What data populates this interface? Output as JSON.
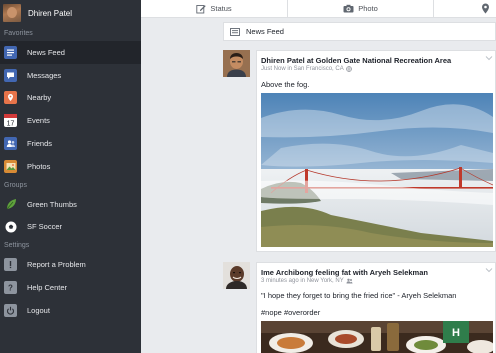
{
  "profile": {
    "name": "Dhiren Patel"
  },
  "sidebar": {
    "favorites_label": "Favorites",
    "groups_label": "Groups",
    "settings_label": "Settings",
    "favorites": [
      {
        "label": "News Feed",
        "icon": "news-feed-icon",
        "color": "#4267b2"
      },
      {
        "label": "Messages",
        "icon": "messages-icon",
        "color": "#4267b2"
      },
      {
        "label": "Nearby",
        "icon": "nearby-icon",
        "color": "#e8744a"
      },
      {
        "label": "Events",
        "icon": "events-icon",
        "color": "#d23a3a"
      },
      {
        "label": "Friends",
        "icon": "friends-icon",
        "color": "#4267b2"
      },
      {
        "label": "Photos",
        "icon": "photos-icon",
        "color": "#d88b35"
      }
    ],
    "groups": [
      {
        "label": "Green Thumbs",
        "icon": "leaf-icon",
        "color": "#5fa23d"
      },
      {
        "label": "SF Soccer",
        "icon": "soccer-ball-icon",
        "color": "#ffffff"
      }
    ],
    "settings": [
      {
        "label": "Report a Problem",
        "icon": "report-icon",
        "color": "#8d949e"
      },
      {
        "label": "Help Center",
        "icon": "help-icon",
        "color": "#8d949e"
      },
      {
        "label": "Logout",
        "icon": "power-icon",
        "color": "#8d949e"
      }
    ]
  },
  "topbar": {
    "status_label": "Status",
    "photo_label": "Photo"
  },
  "feed": {
    "title": "News Feed",
    "posts": [
      {
        "author_line": "Dhiren Patel at Golden Gate National Recreation Area",
        "meta": "Just Now in San Francisco, CA",
        "text": "Above the fog."
      },
      {
        "author_line": "Ime Archibong feeling fat with Aryeh Selekman",
        "meta": "3 minutes ago in New York, NY",
        "text": "\"I hope they forget to bring the fried rice\" - Aryeh Selekman",
        "hashtags": "#nope #overorder"
      }
    ]
  }
}
